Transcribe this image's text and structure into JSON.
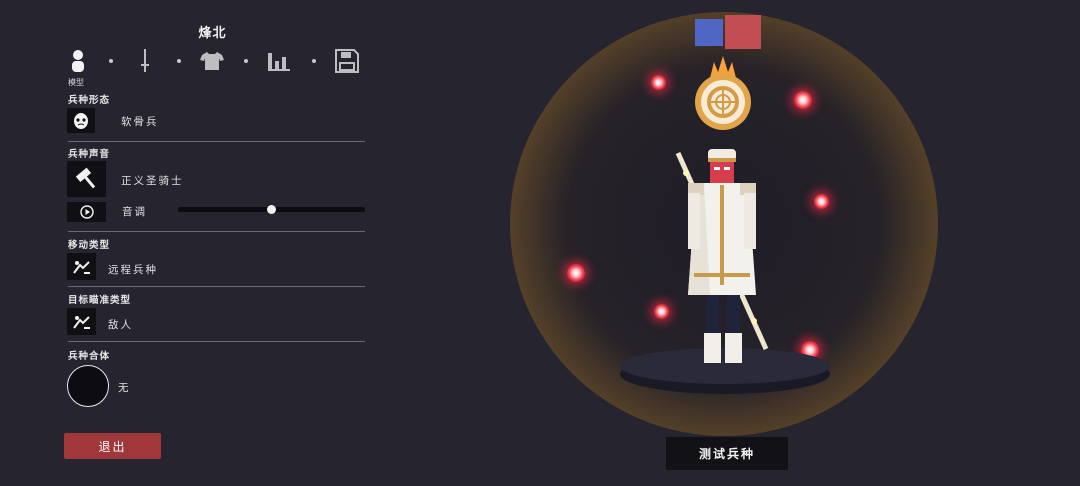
{
  "unit_name": "烽北",
  "tabs": [
    {
      "icon": "person-icon",
      "label": "模型"
    },
    {
      "icon": "sword-icon"
    },
    {
      "icon": "shirt-icon"
    },
    {
      "icon": "stats-bars-icon"
    },
    {
      "icon": "save-disk-icon"
    }
  ],
  "form": {
    "label": "兵种形态",
    "value": "软骨兵"
  },
  "voice": {
    "label": "兵种声音",
    "value": "正义圣骑士",
    "pitch_label": "音调",
    "pitch_level": 0.5
  },
  "movement": {
    "label": "移动类型",
    "value": "远程兵种"
  },
  "targeting": {
    "label": "目标瞄准类型",
    "value": "敌人"
  },
  "merge": {
    "label": "兵种合体",
    "value": "无"
  },
  "buttons": {
    "exit": "退出",
    "test": "测试兵种"
  },
  "team_colors": [
    "#5066c4",
    "#c24d52"
  ],
  "colors": {
    "background": "#25242f",
    "exit_button": "#a0373a",
    "shield_glow": "#f2b54a"
  }
}
